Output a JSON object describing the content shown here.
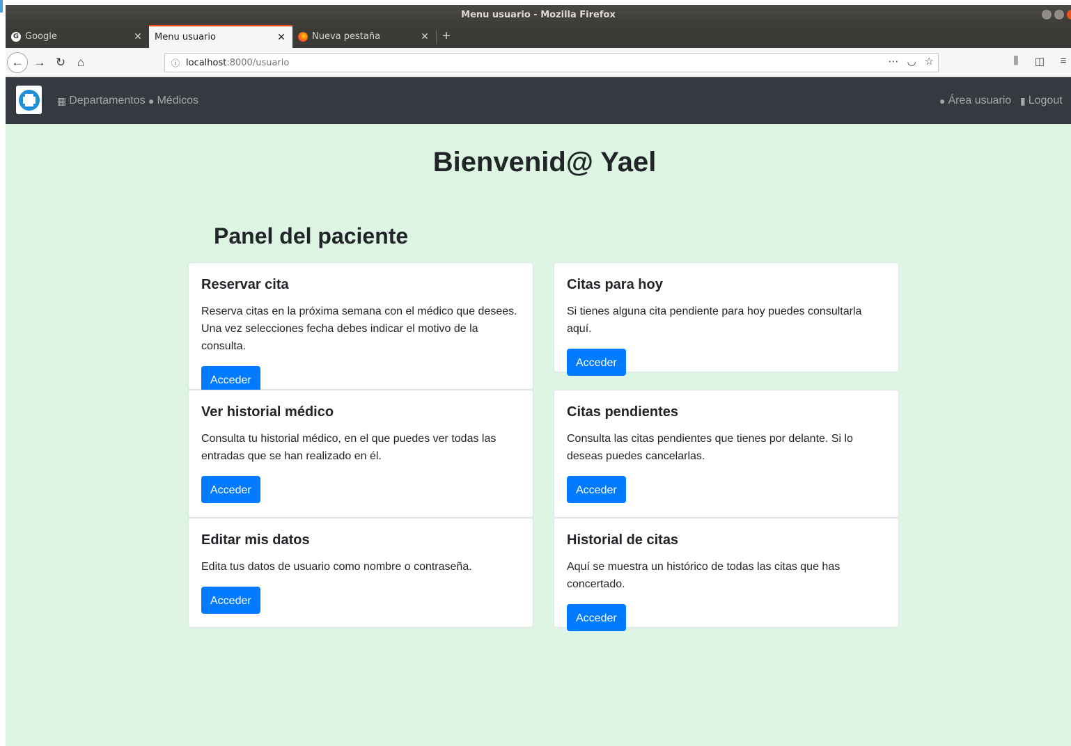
{
  "window": {
    "title": "Menu usuario - Mozilla Firefox"
  },
  "tabs": [
    {
      "label": "Google",
      "icon": "google-icon",
      "active": false
    },
    {
      "label": "Menu usuario",
      "icon": "",
      "active": true
    },
    {
      "label": "Nueva pestaña",
      "icon": "firefox-icon",
      "active": false
    }
  ],
  "urlbar": {
    "host": "localhost",
    "path": ":8000/usuario"
  },
  "site_nav": {
    "departamentos": "Departamentos",
    "medicos": "Médicos",
    "area_usuario": "Área usuario",
    "logout": "Logout"
  },
  "main": {
    "welcome": "Bienvenid@ Yael",
    "panel_title": "Panel del paciente",
    "cards": [
      {
        "title": "Reservar cita",
        "text": "Reserva citas en la próxima semana con el médico que desees. Una vez selecciones fecha debes indicar el motivo de la consulta.",
        "button": "Acceder"
      },
      {
        "title": "Citas para hoy",
        "text": "Si tienes alguna cita pendiente para hoy puedes consultarla aquí.",
        "button": "Acceder"
      },
      {
        "title": "Ver historial médico",
        "text": "Consulta tu historial médico, en el que puedes ver todas las entradas que se han realizado en él.",
        "button": "Acceder"
      },
      {
        "title": "Citas pendientes",
        "text": "Consulta las citas pendientes que tienes por delante. Si lo deseas puedes cancelarlas.",
        "button": "Acceder"
      },
      {
        "title": "Editar mis datos",
        "text": "Edita tus datos de usuario como nombre o contraseña.",
        "button": "Acceder"
      },
      {
        "title": "Historial de citas",
        "text": "Aquí se muestra un histórico de todas las citas que has concertado.",
        "button": "Acceder"
      }
    ]
  },
  "colors": {
    "page_background": "#dff5e3",
    "navbar": "#343a40",
    "primary_button": "#007bff",
    "tab_accent": "#e95420"
  }
}
